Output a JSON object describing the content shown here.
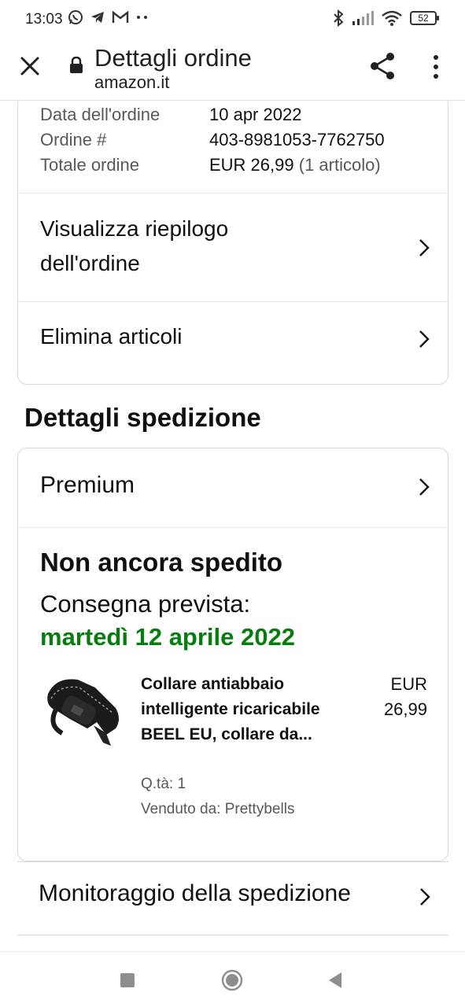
{
  "status_bar": {
    "time": "13:03",
    "left_icons": [
      "whatsapp-icon",
      "telegram-icon",
      "gmail-icon",
      "more-dots-icon"
    ],
    "right_icons": [
      "bluetooth-icon",
      "signal-icon",
      "wifi-icon"
    ],
    "battery": "52"
  },
  "toolbar": {
    "title": "Dettagli ordine",
    "url": "amazon.it"
  },
  "order_summary": {
    "rows": [
      {
        "label": "Data dell'ordine",
        "value": "10 apr 2022",
        "extra": ""
      },
      {
        "label": "Ordine #",
        "value": "403-8981053-7762750",
        "extra": ""
      },
      {
        "label": "Totale ordine",
        "value": "EUR 26,99",
        "extra": "(1 articolo)"
      }
    ],
    "view_summary_label": "Visualizza riepilogo\ndell'ordine",
    "view_summary_line1": "Visualizza riepilogo",
    "view_summary_line2": "dell'ordine",
    "delete_items_label": "Elimina articoli"
  },
  "shipping": {
    "section_title": "Dettagli spedizione",
    "method": "Premium",
    "status": "Non ancora spedito",
    "eta_label": "Consegna prevista:",
    "eta_date": "martedì 12 aprile 2022",
    "product": {
      "title": "Collare antiabbaio intelligente ricaricabile BEEL EU, collare da...",
      "price_currency": "EUR",
      "price_value": "26,99",
      "quantity": "Q.tà: 1",
      "seller": "Venduto da: Prettybells"
    },
    "tracking_label": "Monitoraggio della spedizione"
  },
  "colors": {
    "eta_green": "#067d0e",
    "text": "#0f1111",
    "muted": "#565959",
    "border": "#d5d9d9"
  },
  "nav_bar": [
    "recents-square-icon",
    "home-circle-icon",
    "back-triangle-icon"
  ]
}
